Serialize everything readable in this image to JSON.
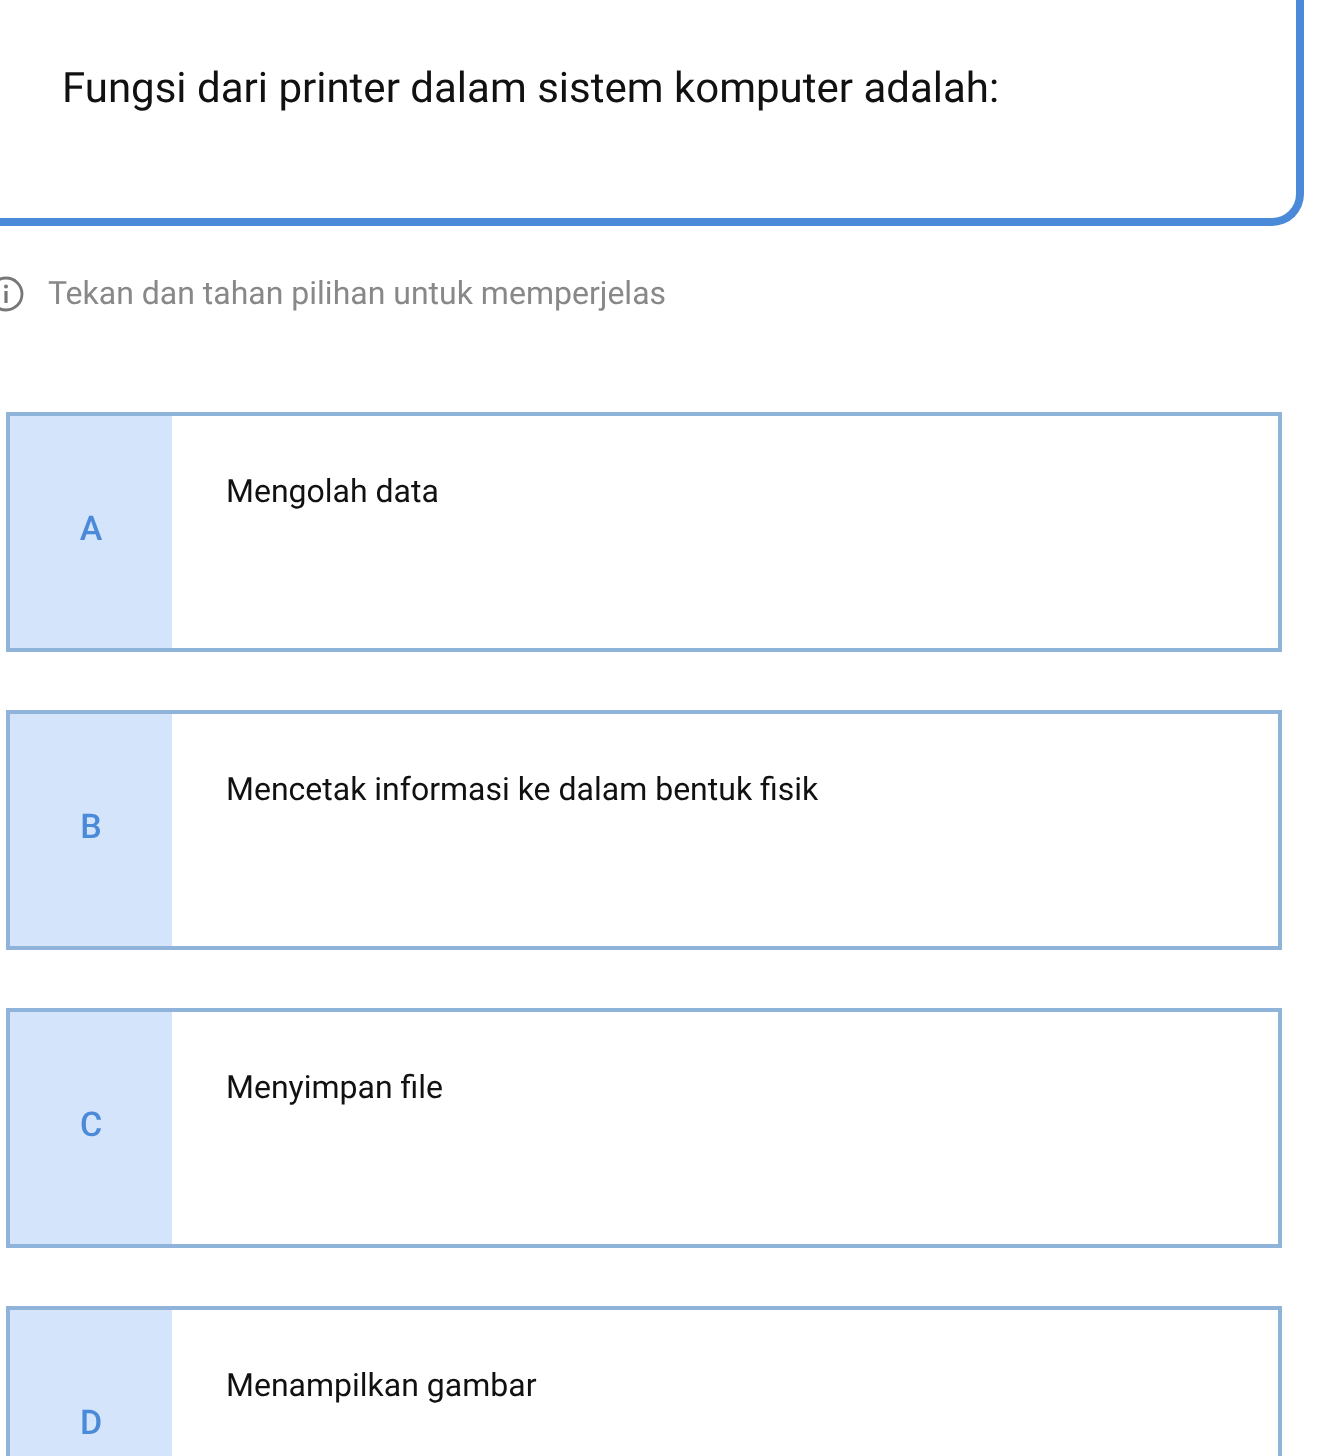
{
  "question": {
    "text": "Fungsi dari printer dalam sistem komputer adalah:"
  },
  "hint": "Tekan dan tahan pilihan untuk memperjelas",
  "options": [
    {
      "letter": "A",
      "text": "Mengolah data"
    },
    {
      "letter": "B",
      "text": "Mencetak informasi ke dalam bentuk fisik"
    },
    {
      "letter": "C",
      "text": "Menyimpan file"
    },
    {
      "letter": "D",
      "text": "Menampilkan gambar"
    }
  ]
}
